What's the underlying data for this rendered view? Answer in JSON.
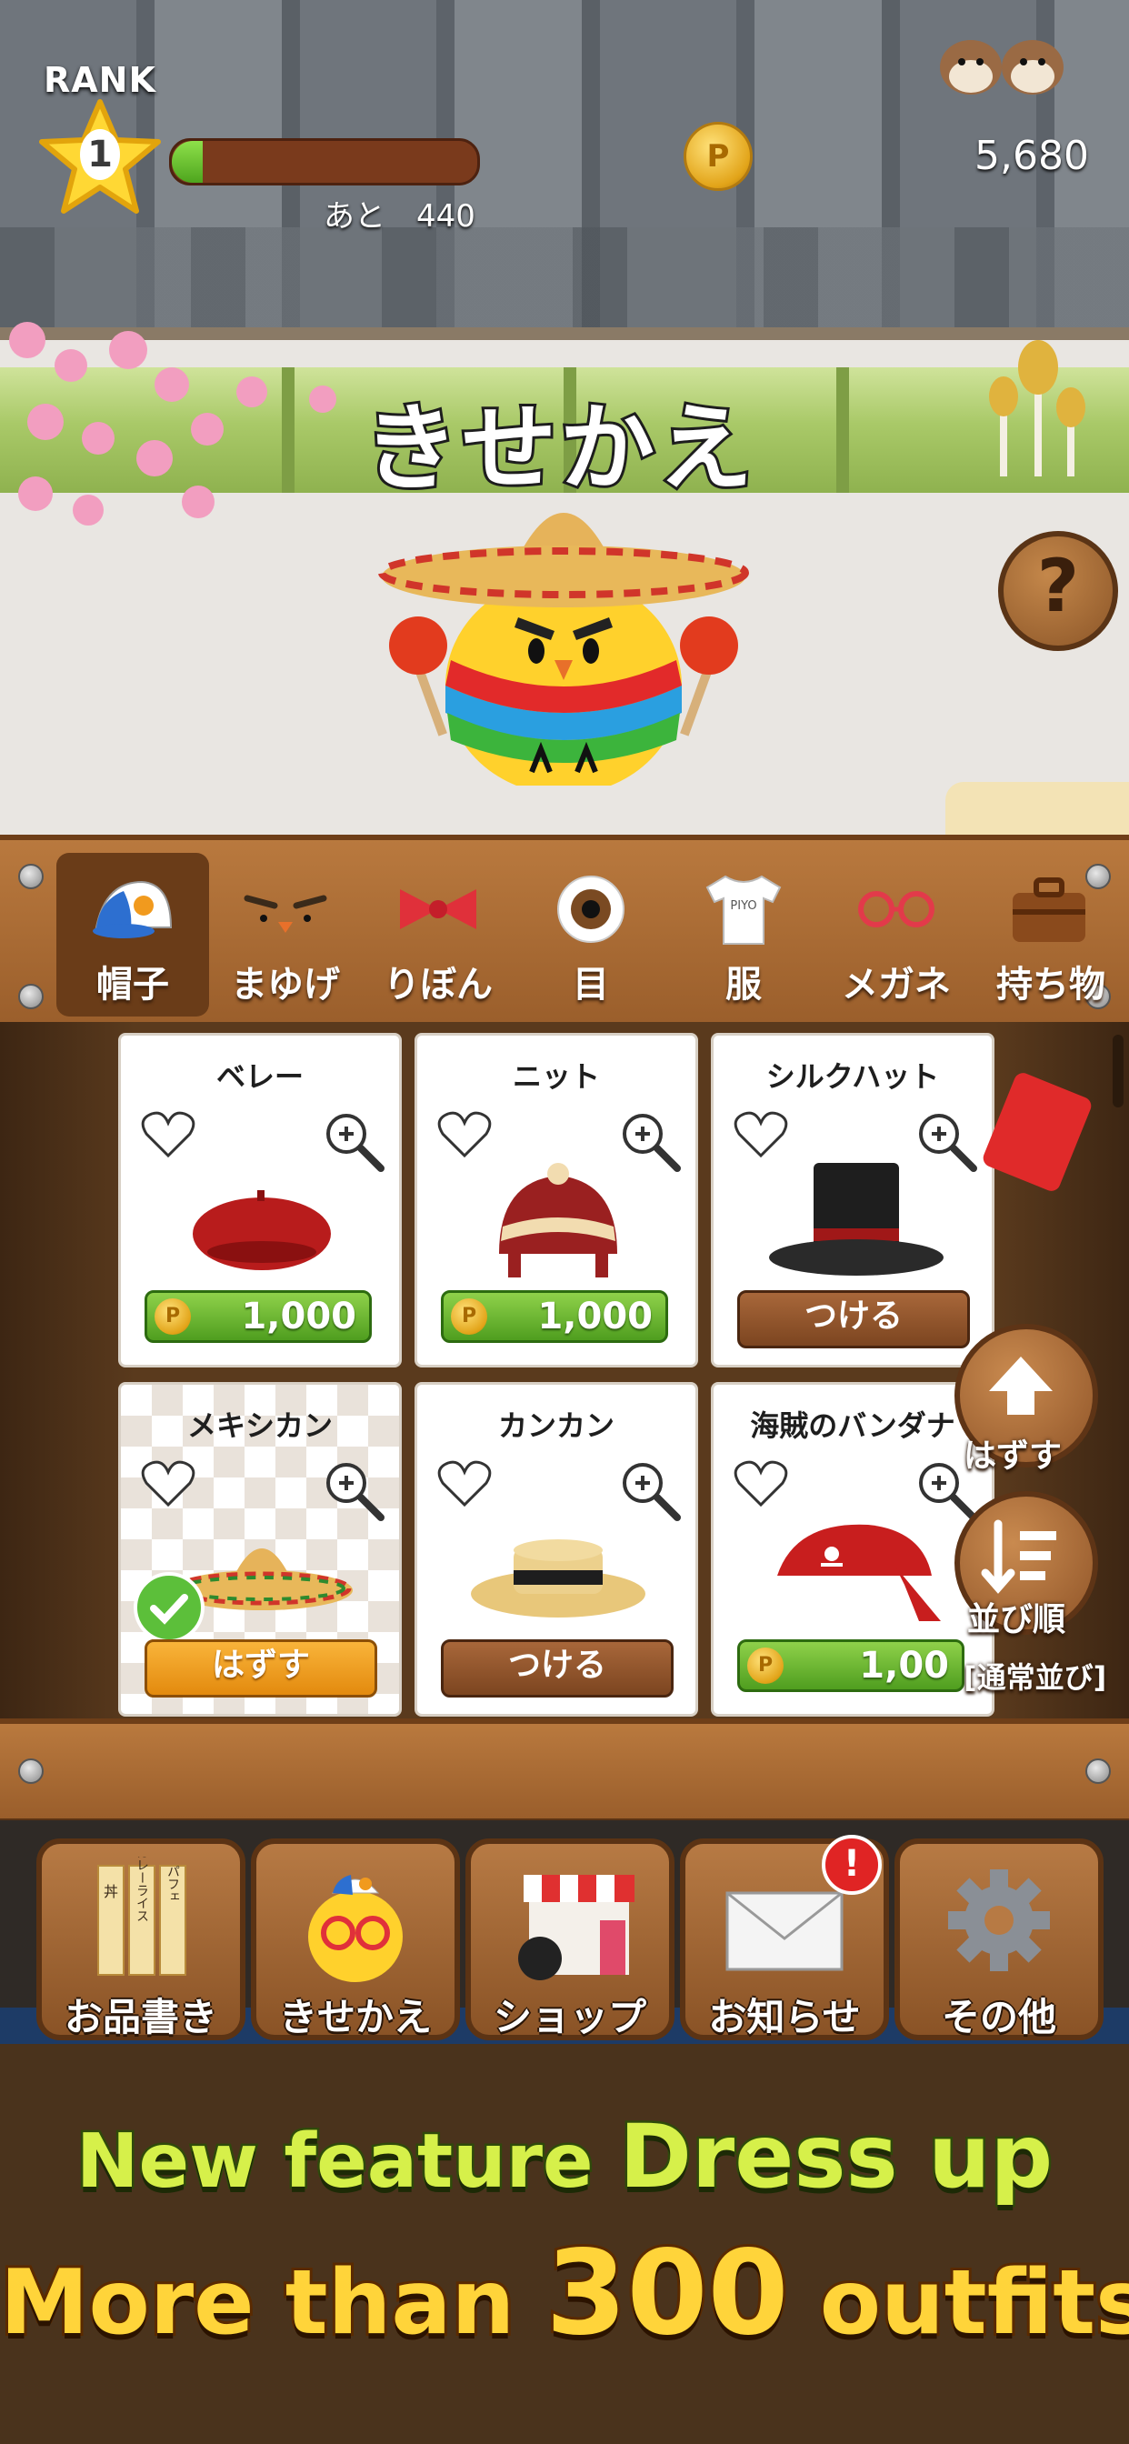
{
  "status": {
    "rank_label": "RANK",
    "rank_value": "1",
    "xp_progress": 0.1,
    "xp_remaining": "あと　440",
    "coin_symbol": "P",
    "coins": "5,680"
  },
  "scene": {
    "title": "きせかえ",
    "help_symbol": "?"
  },
  "categories": [
    {
      "label": "帽子",
      "icon": "cap-icon",
      "active": true
    },
    {
      "label": "まゆげ",
      "icon": "eyebrows-icon",
      "active": false
    },
    {
      "label": "りぼん",
      "icon": "ribbon-icon",
      "active": false
    },
    {
      "label": "目",
      "icon": "eye-icon",
      "active": false
    },
    {
      "label": "服",
      "icon": "tshirt-icon",
      "active": false
    },
    {
      "label": "メガネ",
      "icon": "glasses-icon",
      "active": false
    },
    {
      "label": "持ち物",
      "icon": "briefcase-icon",
      "active": false
    }
  ],
  "tshirt_print": "PIYO",
  "items": [
    {
      "name": "ベレー",
      "action": "price",
      "price": "1,000",
      "icon": "beret-icon"
    },
    {
      "name": "ニット",
      "action": "price",
      "price": "1,000",
      "icon": "knit-hat-icon"
    },
    {
      "name": "シルクハット",
      "action": "equip",
      "button": "つける",
      "icon": "top-hat-icon"
    },
    {
      "name": "メキシカン",
      "action": "remove",
      "button": "はずす",
      "equipped": true,
      "icon": "sombrero-icon"
    },
    {
      "name": "カンカン",
      "action": "equip",
      "button": "つける",
      "icon": "boater-hat-icon"
    },
    {
      "name": "海賊のバンダナ",
      "action": "price",
      "price": "1,00",
      "icon": "pirate-bandana-icon"
    }
  ],
  "side_controls": {
    "remove_label": "はずす",
    "sort_label": "並び順",
    "sort_mode": "[通常並び]"
  },
  "nav": [
    {
      "label": "お品書き",
      "icon": "menu-board-icon"
    },
    {
      "label": "きせかえ",
      "icon": "dress-up-chick-icon"
    },
    {
      "label": "ショップ",
      "icon": "shop-icon"
    },
    {
      "label": "お知らせ",
      "icon": "mail-icon",
      "badge": "!"
    },
    {
      "label": "その他",
      "icon": "gear-icon"
    }
  ],
  "menu_board_text": [
    "丼",
    "カレーライス",
    "パフェ"
  ],
  "promo": {
    "line1_a": "New feature ",
    "line1_b": "Dress up",
    "line2_a": "More than ",
    "line2_b": "300",
    "line2_c": " outfits!"
  },
  "colors": {
    "wood": "#9a5e2b",
    "price_green": "#4f9e1f",
    "remove_orange": "#e38a0e",
    "promo_yellow": "#ffd43a",
    "promo_green": "#d6f04a"
  }
}
